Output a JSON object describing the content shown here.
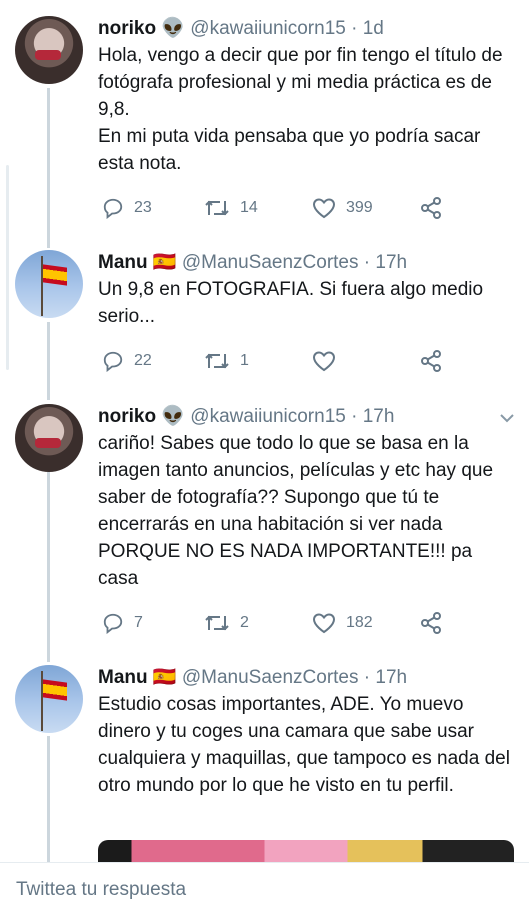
{
  "tweets": [
    {
      "name": "noriko",
      "name_emoji": "👽",
      "handle": "@kawaiiunicorn15",
      "time": "· 1d",
      "lines": [
        "Hola, vengo a decir que por fin tengo el título de fotógrafa profesional y mi media práctica es de 9,8.",
        "En mi puta vida pensaba que yo podría sacar esta nota."
      ],
      "replies": "23",
      "retweets": "14",
      "likes": "399"
    },
    {
      "name": "Manu",
      "name_emoji": "🇪🇸",
      "handle": "@ManuSaenzCortes",
      "time": "· 17h",
      "lines": [
        "Un 9,8 en FOTOGRAFIA. Si fuera algo medio serio..."
      ],
      "replies": "22",
      "retweets": "1",
      "likes": ""
    },
    {
      "name": "noriko",
      "name_emoji": "👽",
      "handle": "@kawaiiunicorn15",
      "time": "· 17h",
      "lines": [
        "cariño! Sabes que todo lo que se basa en la imagen tanto anuncios, películas y etc hay que saber de fotografía?? Supongo que tú te encerrarás en una habitación si ver nada PORQUE NO ES NADA IMPORTANTE!!! pa casa"
      ],
      "replies": "7",
      "retweets": "2",
      "likes": "182"
    },
    {
      "name": "Manu",
      "name_emoji": "🇪🇸",
      "handle": "@ManuSaenzCortes",
      "time": "· 17h",
      "lines": [
        "Estudio cosas importantes, ADE. Yo muevo dinero y tu coges una camara que sabe usar cualquiera y maquillas, que tampoco es nada del otro mundo por lo que he visto en tu perfil."
      ]
    }
  ],
  "reply_bar": {
    "placeholder": "Twittea tu respuesta"
  },
  "colors": {
    "text": "#14171a",
    "secondary": "#657786",
    "thread_line": "#ccd6dd",
    "background": "#ffffff"
  }
}
